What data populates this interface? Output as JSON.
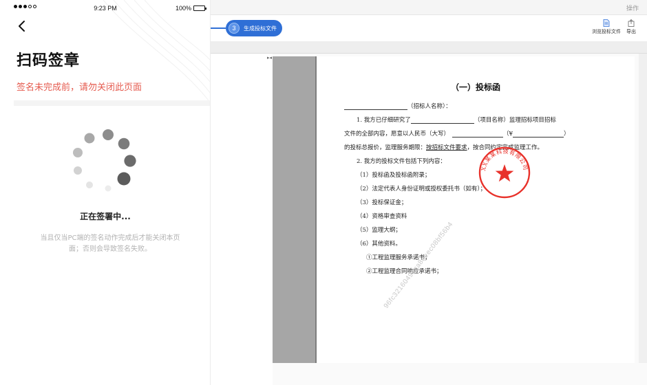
{
  "desktop": {
    "topbar_right": "操作",
    "step": {
      "number": "3",
      "label": "生成投标文件"
    },
    "toolbar": {
      "browse_label": "浏览投标文件",
      "export_label": "导出"
    },
    "document": {
      "title": "（一）投标函",
      "recipient_suffix": "（招标人名称）：",
      "p1_l1_a": "1. 我方已仔细研究了",
      "p1_l1_b": "（项目名称）监理招标项目招标",
      "p1_l2_a": "文件的全部内容，愿意以人民币（大写）",
      "p1_l2_b": "（¥",
      "p1_l2_c": "）",
      "p1_l3_a": "的投标总报价，监理服务期限：",
      "p1_l3_b": "按招标文件要求",
      "p1_l3_c": "，按合同约定完成监理工作。",
      "p2": "2. 我方的投标文件包括下列内容：",
      "items": [
        "（1）投标函及投标函附录；",
        "（2）法定代表人身份证明或授权委托书（如有）；",
        "（3）投标保证金；",
        "（4）资格审查资料",
        "（5）监理大纲；",
        "（6）其他资料。"
      ],
      "subitems": [
        "①工程监理服务承诺书；",
        "②工程监理合同响应承诺书；"
      ],
      "seal_text": "XX某某科技有限公司",
      "watermark": "96fc3216049bca8eeec08bf56b4"
    }
  },
  "phone": {
    "status": {
      "time": "9:23 PM",
      "battery": "100%"
    },
    "title": "扫码签章",
    "warning": "签名未完成前，请勿关闭此页面",
    "status_text": "正在签署中...",
    "note": "当且仅当PC端的签名动作完成后才能关闭本页面；否则会导致签名失败。"
  },
  "colors": {
    "accent": "#2f6fd6",
    "warning": "#e55a4e",
    "seal_red": "#e8312a"
  },
  "icons": [
    "back-arrow-icon",
    "spinner-icon",
    "browse-file-icon",
    "export-icon",
    "signal-icon",
    "battery-icon",
    "seal-star-icon"
  ]
}
